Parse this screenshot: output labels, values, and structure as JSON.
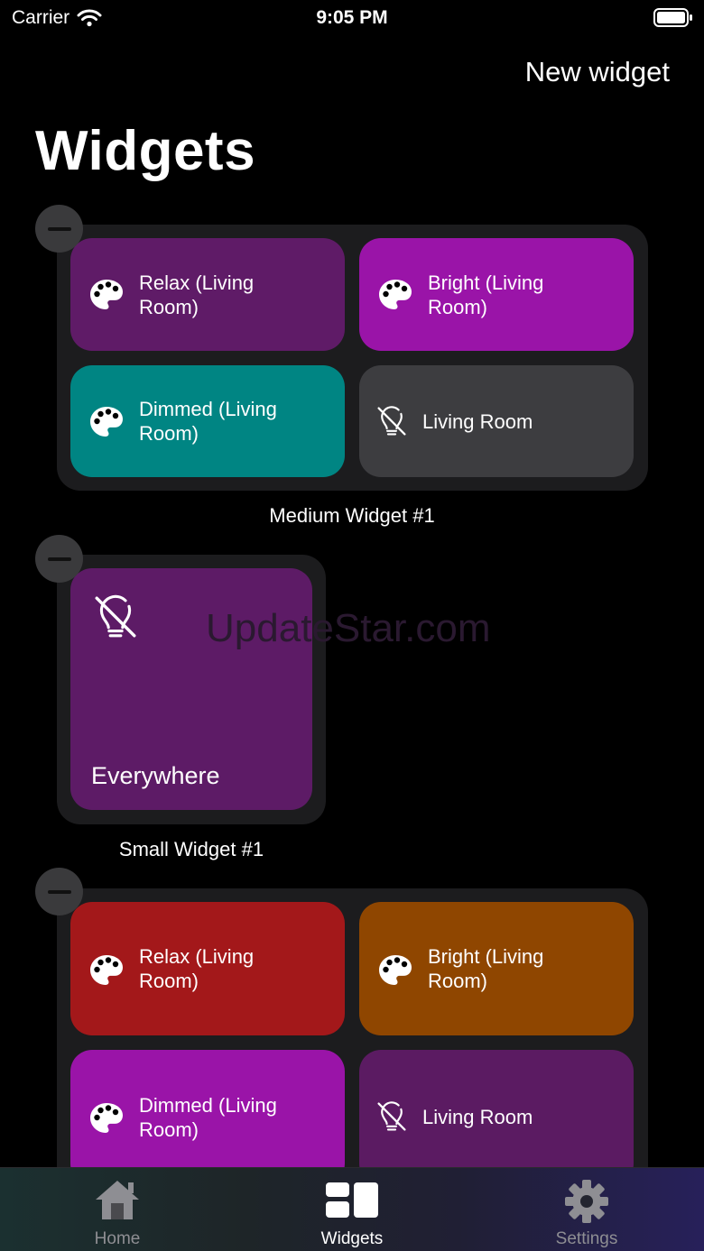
{
  "status_bar": {
    "carrier": "Carrier",
    "time": "9:05 PM"
  },
  "header": {
    "new_widget_label": "New widget",
    "title": "Widgets"
  },
  "watermark": "UpdateStar.com",
  "medium_widget_1": {
    "caption": "Medium Widget #1",
    "tiles": [
      {
        "label": "Relax (Living Room)",
        "icon": "palette-icon",
        "color": "#5f1b67"
      },
      {
        "label": "Bright (Living Room)",
        "icon": "palette-icon",
        "color": "#9a14a8"
      },
      {
        "label": "Dimmed (Living Room)",
        "icon": "palette-icon",
        "color": "#008583"
      },
      {
        "label": "Living Room",
        "icon": "lightbulb-off-icon",
        "color": "#3d3d40"
      }
    ]
  },
  "small_widget_1": {
    "caption": "Small Widget #1",
    "tile": {
      "label": "Everywhere",
      "icon": "lightbulb-off-icon",
      "color": "#5d1b66"
    }
  },
  "medium_widget_2": {
    "tiles": [
      {
        "label": "Relax (Living Room)",
        "icon": "palette-icon",
        "color": "#a3181a"
      },
      {
        "label": "Bright (Living Room)",
        "icon": "palette-icon",
        "color": "#8f4600"
      },
      {
        "label": "Dimmed (Living Room)",
        "icon": "palette-icon",
        "color": "#9a14a8"
      },
      {
        "label": "Living Room",
        "icon": "lightbulb-off-icon",
        "color": "#5b1b62"
      }
    ]
  },
  "tab_bar": {
    "tabs": [
      {
        "label": "Home",
        "icon": "house-icon",
        "active": false
      },
      {
        "label": "Widgets",
        "icon": "widgets-icon",
        "active": true
      },
      {
        "label": "Settings",
        "icon": "gear-icon",
        "active": false
      }
    ],
    "active_color": "#ffffff",
    "inactive_color": "#8e8e93"
  }
}
